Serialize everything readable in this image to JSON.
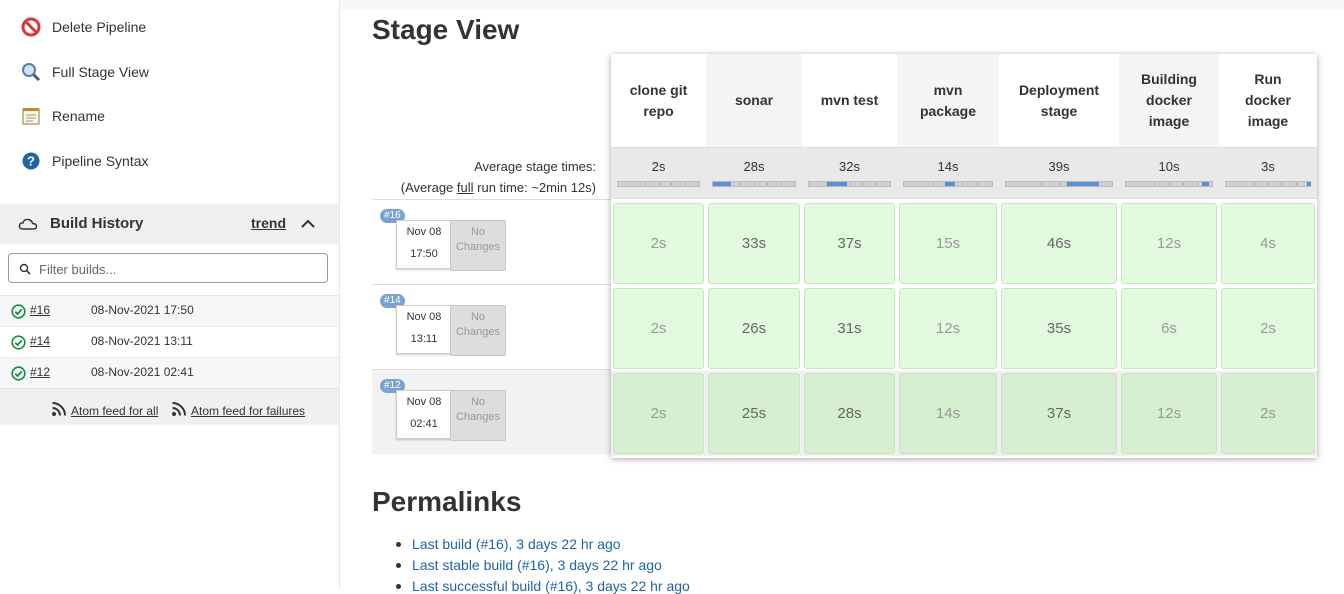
{
  "sidebar": {
    "tasks": [
      {
        "label": "Delete Pipeline",
        "icon": "delete-icon"
      },
      {
        "label": "Full Stage View",
        "icon": "magnifier-icon"
      },
      {
        "label": "Rename",
        "icon": "notepad-icon"
      },
      {
        "label": "Pipeline Syntax",
        "icon": "help-icon"
      }
    ],
    "build_history": {
      "title": "Build History",
      "trend": "trend",
      "filter_placeholder": "Filter builds...",
      "builds": [
        {
          "number": "#16",
          "date": "08-Nov-2021 17:50",
          "status": "success"
        },
        {
          "number": "#14",
          "date": "08-Nov-2021 13:11",
          "status": "success"
        },
        {
          "number": "#12",
          "date": "08-Nov-2021 02:41",
          "status": "success"
        }
      ],
      "feed_all": "Atom feed for all",
      "feed_failures": "Atom feed for failures"
    }
  },
  "main": {
    "stage_view_title": "Stage View",
    "avg_stage_label": "Average stage times:",
    "avg_run_prefix": "(Average ",
    "avg_run_full": "full",
    "avg_run_suffix": " run time: ~2min 12s)",
    "stages": [
      {
        "name": "clone git repo",
        "lines": [
          "clone git",
          "repo"
        ],
        "avg": "2s",
        "fill_start": 0.0,
        "fill_end": 0.0
      },
      {
        "name": "sonar",
        "lines": [
          "sonar"
        ],
        "avg": "28s",
        "fill_start": 0.0,
        "fill_end": 0.22
      },
      {
        "name": "mvn test",
        "lines": [
          "mvn test"
        ],
        "avg": "32s",
        "fill_start": 0.22,
        "fill_end": 0.47
      },
      {
        "name": "mvn package",
        "lines": [
          "mvn",
          "package"
        ],
        "avg": "14s",
        "fill_start": 0.47,
        "fill_end": 0.58
      },
      {
        "name": "Deployment stage",
        "lines": [
          "Deployment",
          "stage"
        ],
        "avg": "39s",
        "fill_start": 0.58,
        "fill_end": 0.88
      },
      {
        "name": "Building docker image",
        "lines": [
          "Building",
          "docker",
          "image"
        ],
        "avg": "10s",
        "fill_start": 0.88,
        "fill_end": 0.96
      },
      {
        "name": "Run docker image",
        "lines": [
          "Run",
          "docker",
          "image"
        ],
        "avg": "3s",
        "fill_start": 0.96,
        "fill_end": 0.98
      }
    ],
    "runs": [
      {
        "badge": "#16",
        "date": "Nov 08",
        "time": "17:50",
        "changes": [
          "No",
          "Changes"
        ],
        "durations": [
          "2s",
          "33s",
          "37s",
          "15s",
          "46s",
          "12s",
          "4s"
        ]
      },
      {
        "badge": "#14",
        "date": "Nov 08",
        "time": "13:11",
        "changes": [
          "No",
          "Changes"
        ],
        "durations": [
          "2s",
          "26s",
          "31s",
          "12s",
          "35s",
          "6s",
          "2s"
        ]
      },
      {
        "badge": "#12",
        "date": "Nov 08",
        "time": "02:41",
        "changes": [
          "No",
          "Changes"
        ],
        "durations": [
          "2s",
          "25s",
          "28s",
          "14s",
          "37s",
          "12s",
          "2s"
        ]
      }
    ],
    "permalinks_title": "Permalinks",
    "permalinks": [
      "Last build (#16), 3 days 22 hr ago",
      "Last stable build (#16), 3 days 22 hr ago",
      "Last successful build (#16), 3 days 22 hr ago"
    ]
  },
  "colors": {
    "success_cell": "#e2fbde",
    "success_cell_dark": "#d5efd0",
    "accent_blue": "#5b8fd1",
    "link": "#1f64a6"
  }
}
